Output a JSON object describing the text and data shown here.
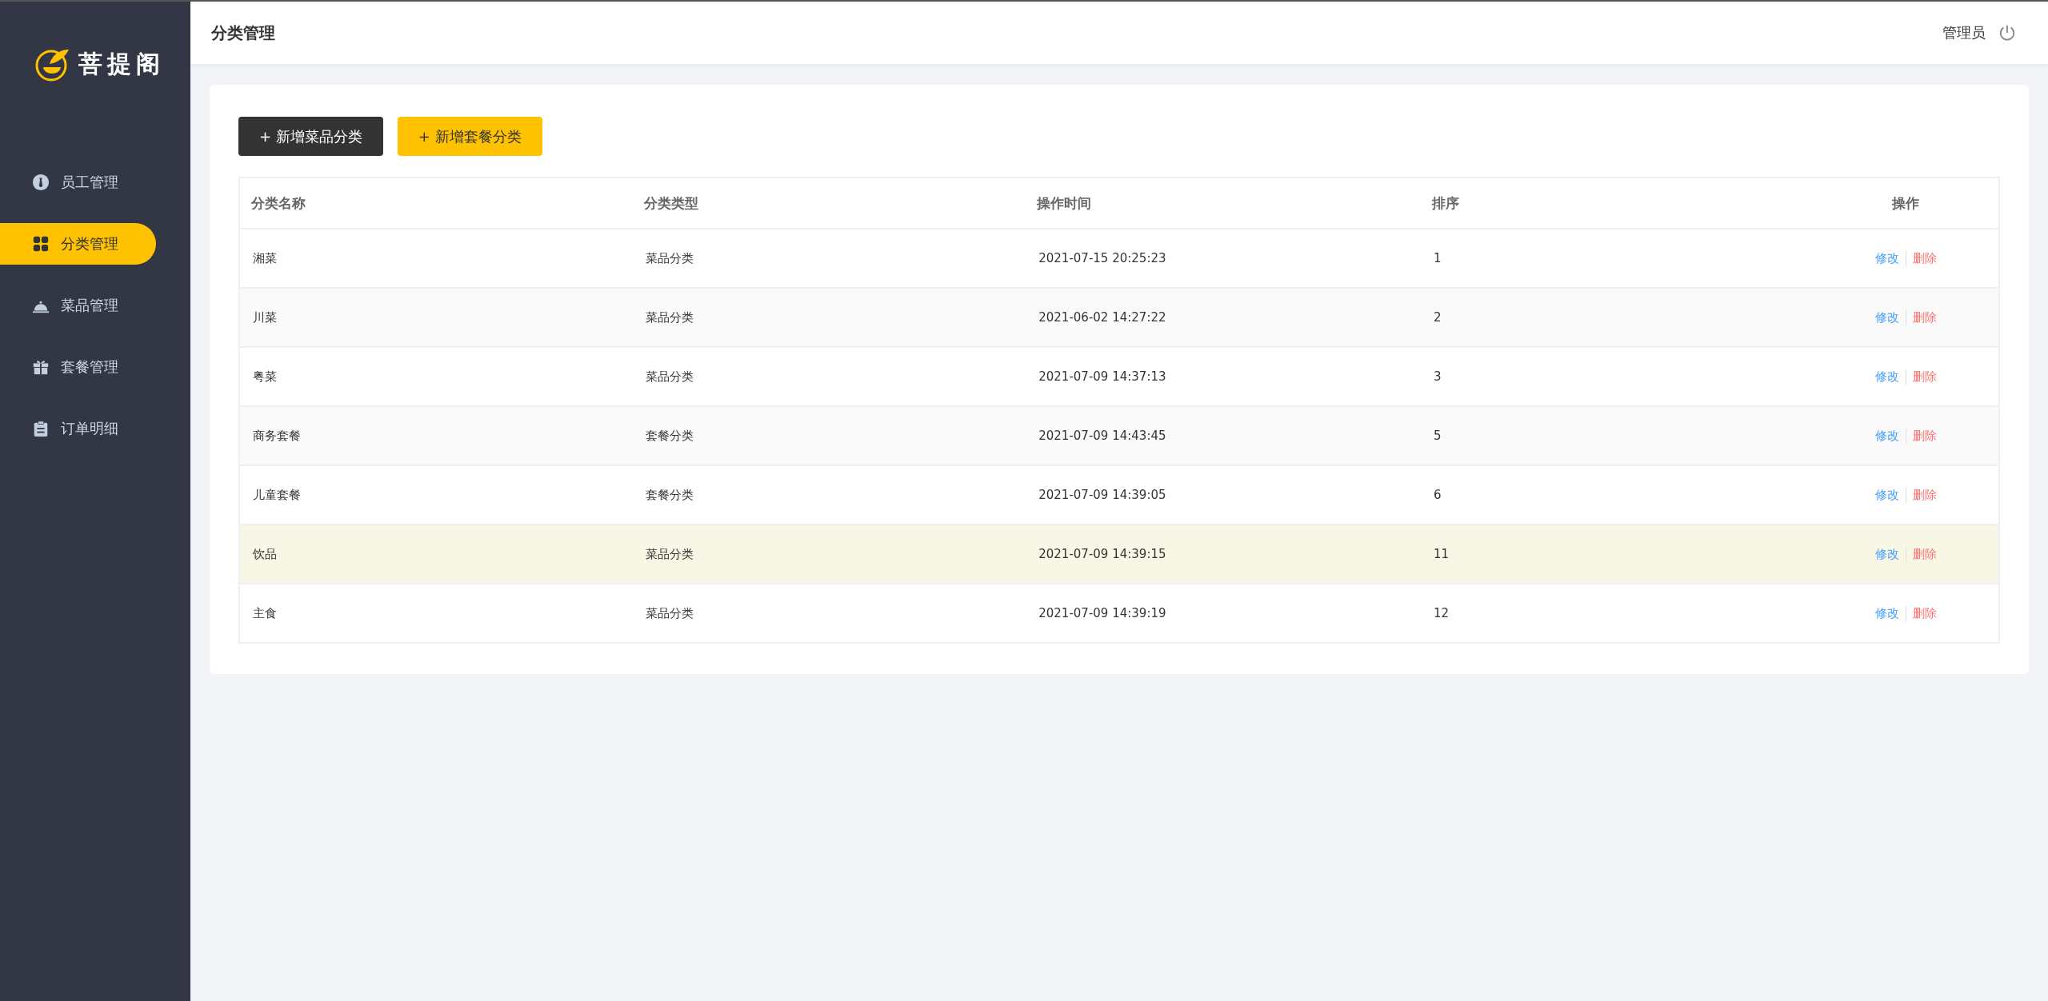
{
  "sidebar": {
    "logo": {
      "text": "菩提阁"
    },
    "items": [
      {
        "label": "员工管理",
        "selected": false
      },
      {
        "label": "分类管理",
        "selected": true
      },
      {
        "label": "菜品管理",
        "selected": false
      },
      {
        "label": "套餐管理",
        "selected": false
      },
      {
        "label": "订单明细",
        "selected": false
      }
    ]
  },
  "header": {
    "title": "分类管理",
    "user": "管理员"
  },
  "buttons": [
    {
      "label": "+ 新增菜品分类",
      "kind": "dark"
    },
    {
      "label": "+ 新增套餐分类",
      "kind": "primary"
    }
  ],
  "table": {
    "columns": [
      "分类名称",
      "分类类型",
      "操作时间",
      "排序",
      "操作"
    ],
    "rows": [
      {
        "name": "湘菜",
        "type": "菜品分类",
        "time": "2021-07-15 20:25:23",
        "sort": "1",
        "edit": "修改",
        "delete": "删除",
        "hovered": false
      },
      {
        "name": "川菜",
        "type": "菜品分类",
        "time": "2021-06-02 14:27:22",
        "sort": "2",
        "edit": "修改",
        "delete": "删除",
        "hovered": false
      },
      {
        "name": "粤菜",
        "type": "菜品分类",
        "time": "2021-07-09 14:37:13",
        "sort": "3",
        "edit": "修改",
        "delete": "删除",
        "hovered": false
      },
      {
        "name": "商务套餐",
        "type": "套餐分类",
        "time": "2021-07-09 14:43:45",
        "sort": "5",
        "edit": "修改",
        "delete": "删除",
        "hovered": false
      },
      {
        "name": "儿童套餐",
        "type": "套餐分类",
        "time": "2021-07-09 14:39:05",
        "sort": "6",
        "edit": "修改",
        "delete": "删除",
        "hovered": false
      },
      {
        "name": "饮品",
        "type": "菜品分类",
        "time": "2021-07-09 14:39:15",
        "sort": "11",
        "edit": "修改",
        "delete": "删除",
        "hovered": true
      },
      {
        "name": "主食",
        "type": "菜品分类",
        "time": "2021-07-09 14:39:19",
        "sort": "12",
        "edit": "修改",
        "delete": "删除",
        "hovered": false
      }
    ]
  }
}
